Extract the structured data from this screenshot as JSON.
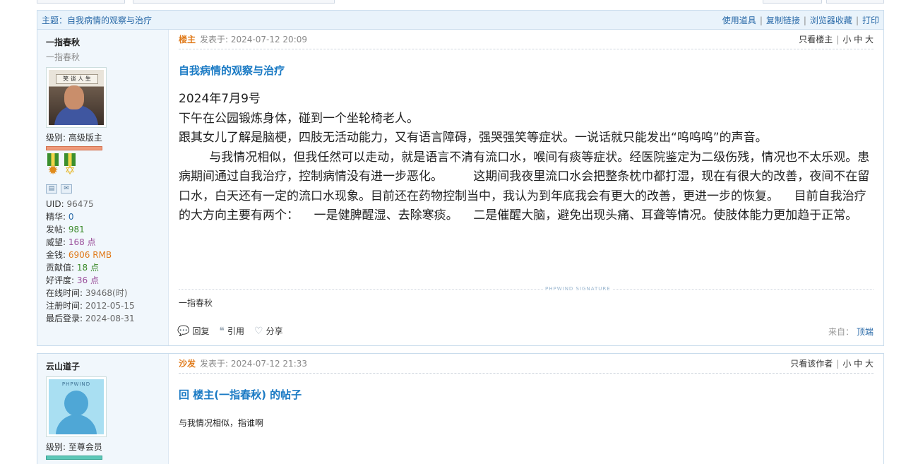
{
  "topic_bar": {
    "subject_label": "主题：",
    "subject": "自我病情的观察与治疗",
    "links": [
      "使用道具",
      "复制链接",
      "浏览器收藏",
      "打印"
    ]
  },
  "post1": {
    "user": {
      "name": "一指春秋",
      "subtitle": "一指春秋",
      "level_label": "级别:",
      "level": "高级版主",
      "stats": [
        {
          "label": "UID:",
          "value": "96475",
          "cls": "v-gray"
        },
        {
          "label": "精华:",
          "value": "0",
          "cls": "v-blue"
        },
        {
          "label": "发帖:",
          "value": "981",
          "cls": "v-green"
        },
        {
          "label": "威望:",
          "value": "168 点",
          "cls": "v-purple"
        },
        {
          "label": "金钱:",
          "value": "6906 RMB",
          "cls": "v-orange"
        },
        {
          "label": "贡献值:",
          "value": "18 点",
          "cls": "v-green"
        },
        {
          "label": "好评度:",
          "value": "36 点",
          "cls": "v-purple"
        },
        {
          "label": "在线时间:",
          "value": "39468(时)",
          "cls": "v-gray"
        },
        {
          "label": "注册时间:",
          "value": "2012-05-15",
          "cls": "v-gray"
        },
        {
          "label": "最后登录:",
          "value": "2024-08-31",
          "cls": "v-gray"
        }
      ]
    },
    "role": "楼主",
    "posted": "发表于: 2024-07-12 20:09",
    "meta_right": {
      "only": "只看楼主",
      "sizes": "小 中 大"
    },
    "title": "自我病情的观察与治疗",
    "body_lines": [
      "2024年7月9号",
      "下午在公园锻炼身体，碰到一个坐轮椅老人。",
      "跟其女儿了解是脑梗，四肢无活动能力，又有语言障碍，强哭强笑等症状。一说话就只能发出“呜呜呜”的声音。",
      "        与我情况相似，但我任然可以走动，就是语言不清有流口水，喉间有痰等症状。经医院鉴定为二级伤残，情况也不太乐观。患病期间通过自我治疗，控制病情没有进一步恶化。        这期间我夜里流口水会把整条枕巾都打湿，现在有很大的改善，夜间不在留口水，白天还有一定的流口水现象。目前还在药物控制当中，我认为到年底我会有更大的改善，更进一步的恢复。    目前自我治疗的大方向主要有两个：    一是健脾醒湿、去除寒痰。    二是催醒大脑，避免出现头痛、耳聋等情况。使肢体能力更加趋于正常。"
    ],
    "signature_tag": "PHPWIND SIGNATURE",
    "signature": "一指春秋",
    "actions": [
      "回复",
      "引用",
      "分享"
    ],
    "from_label": "来自：",
    "from_device": "顶端"
  },
  "post2": {
    "user": {
      "name": "云山道子",
      "avatar_label": "PHPWIND",
      "level_label": "级别:",
      "level": "至尊会员"
    },
    "role": "沙发",
    "posted": "发表于: 2024-07-12 21:33",
    "meta_right": {
      "only": "只看该作者",
      "sizes": "小 中 大"
    },
    "title": "回 楼主(一指春秋) 的帖子",
    "body": "与我情况相似，指谁啊"
  }
}
